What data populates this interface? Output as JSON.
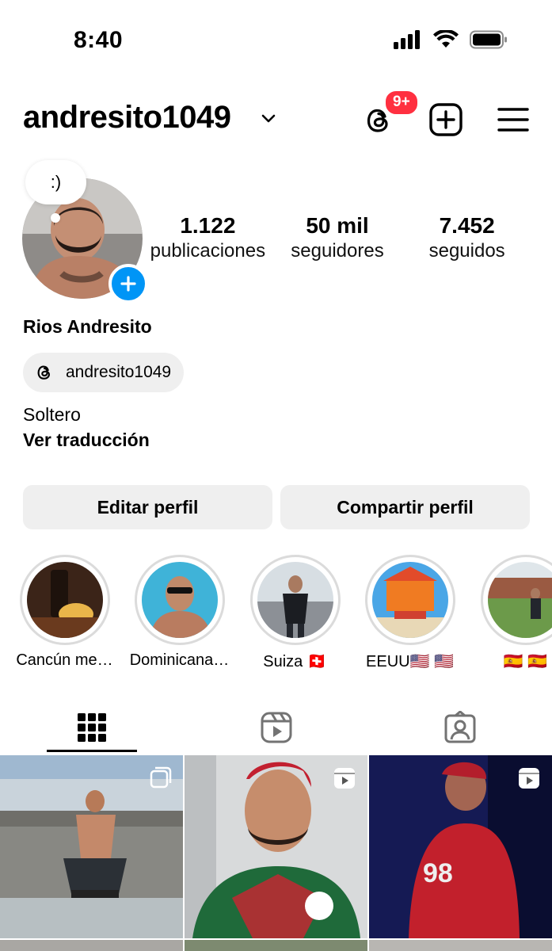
{
  "status_bar": {
    "time": "8:40"
  },
  "header": {
    "username": "andresito1049",
    "threads_badge": "9+"
  },
  "profile": {
    "note": ":)",
    "stats": [
      {
        "value": "1.122",
        "label": "publicaciones"
      },
      {
        "value": "50 mil",
        "label": "seguidores"
      },
      {
        "value": "7.452",
        "label": "seguidos"
      }
    ],
    "display_name": "Rios Andresito",
    "threads_handle": "andresito1049",
    "bio": "Soltero",
    "translate_label": "Ver traducción"
  },
  "buttons": {
    "edit": "Editar perfil",
    "share": "Compartir perfil"
  },
  "highlights": [
    {
      "label": "Cancún me…"
    },
    {
      "label": "Dominicana…"
    },
    {
      "label": "Suiza 🇨🇭"
    },
    {
      "label": "EEUU🇺🇸 🇺🇸"
    },
    {
      "label": "🇪🇸 🇪🇸"
    }
  ],
  "tabs": [
    "grid-tab",
    "reels-tab",
    "tagged-tab"
  ],
  "colors": {
    "accent_blue": "#0095f6",
    "badge_red": "#ff3040",
    "button_gray": "#efefef"
  }
}
